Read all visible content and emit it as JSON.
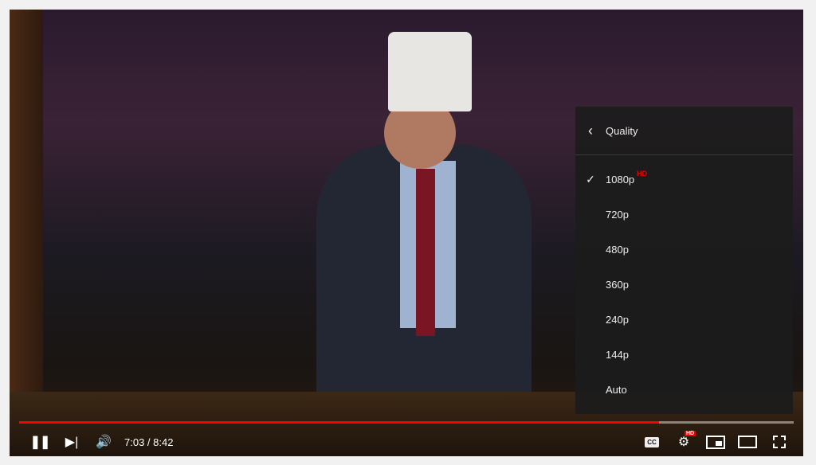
{
  "player": {
    "progress_percent": 82.6,
    "time_current": "7:03",
    "time_separator": " / ",
    "time_total": "8:42",
    "accent": "#ff0000"
  },
  "menu": {
    "title": "Quality",
    "hd_badge": "HD",
    "selected": "1080p",
    "items": [
      {
        "label": "1080p"
      },
      {
        "label": "720p"
      },
      {
        "label": "480p"
      },
      {
        "label": "360p"
      },
      {
        "label": "240p"
      },
      {
        "label": "144p"
      },
      {
        "label": "Auto"
      }
    ]
  },
  "controls": {
    "cc_label": "CC",
    "settings_badge": "HD",
    "icons": [
      "pause-icon",
      "next-icon",
      "volume-icon",
      "captions-icon",
      "settings-icon",
      "miniplayer-icon",
      "theater-icon",
      "fullscreen-icon"
    ]
  }
}
